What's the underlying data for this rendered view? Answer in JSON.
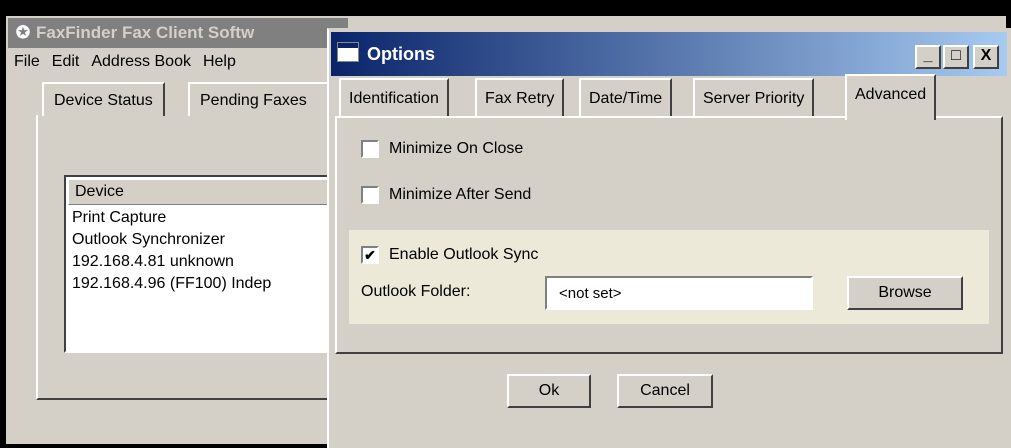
{
  "background_window": {
    "title": "FaxFinder Fax Client Softw",
    "menu": [
      "File",
      "Edit",
      "Address Book",
      "Help"
    ],
    "tabs": [
      "Device Status",
      "Pending Faxes"
    ],
    "list": {
      "header": "Device",
      "rows": [
        "Print Capture",
        "Outlook Synchronizer",
        "192.168.4.81  unknown",
        "192.168.4.96 (FF100) Indep"
      ]
    }
  },
  "dialog": {
    "title": "Options",
    "controls": {
      "minimize": "_",
      "maximize": "□",
      "close": "X"
    },
    "tabs": [
      "Identification",
      "Fax Retry",
      "Date/Time",
      "Server Priority",
      "Advanced"
    ],
    "active_tab": "Advanced",
    "options": {
      "minimize_on_close": {
        "label": "Minimize On Close",
        "checked": false
      },
      "minimize_after_send": {
        "label": "Minimize After Send",
        "checked": false
      },
      "enable_outlook_sync": {
        "label": "Enable Outlook Sync",
        "checked": true,
        "check_mark": "✔"
      }
    },
    "outlook_folder": {
      "label": "Outlook Folder:",
      "value": "<not set>"
    },
    "browse_label": "Browse",
    "ok_label": "Ok",
    "cancel_label": "Cancel"
  },
  "colors": {
    "face": "#d4d0c8",
    "title_active": "#0a246a",
    "title_gradient_end": "#a6caf0",
    "title_inactive": "#808080",
    "group_bg": "#ece9d8"
  }
}
